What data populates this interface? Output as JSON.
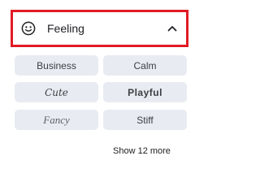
{
  "header": {
    "title": "Feeling",
    "icon": "smiley-face-icon",
    "toggle_icon": "chevron-up-icon",
    "highlight_color": "#e01b24"
  },
  "options": [
    {
      "label": "Business"
    },
    {
      "label": "Calm"
    },
    {
      "label": "Cute"
    },
    {
      "label": "Playful"
    },
    {
      "label": "Fancy"
    },
    {
      "label": "Stiff"
    }
  ],
  "show_more_label": "Show 12 more",
  "colors": {
    "chip_background": "#e8ecf2",
    "text": "#202124"
  }
}
